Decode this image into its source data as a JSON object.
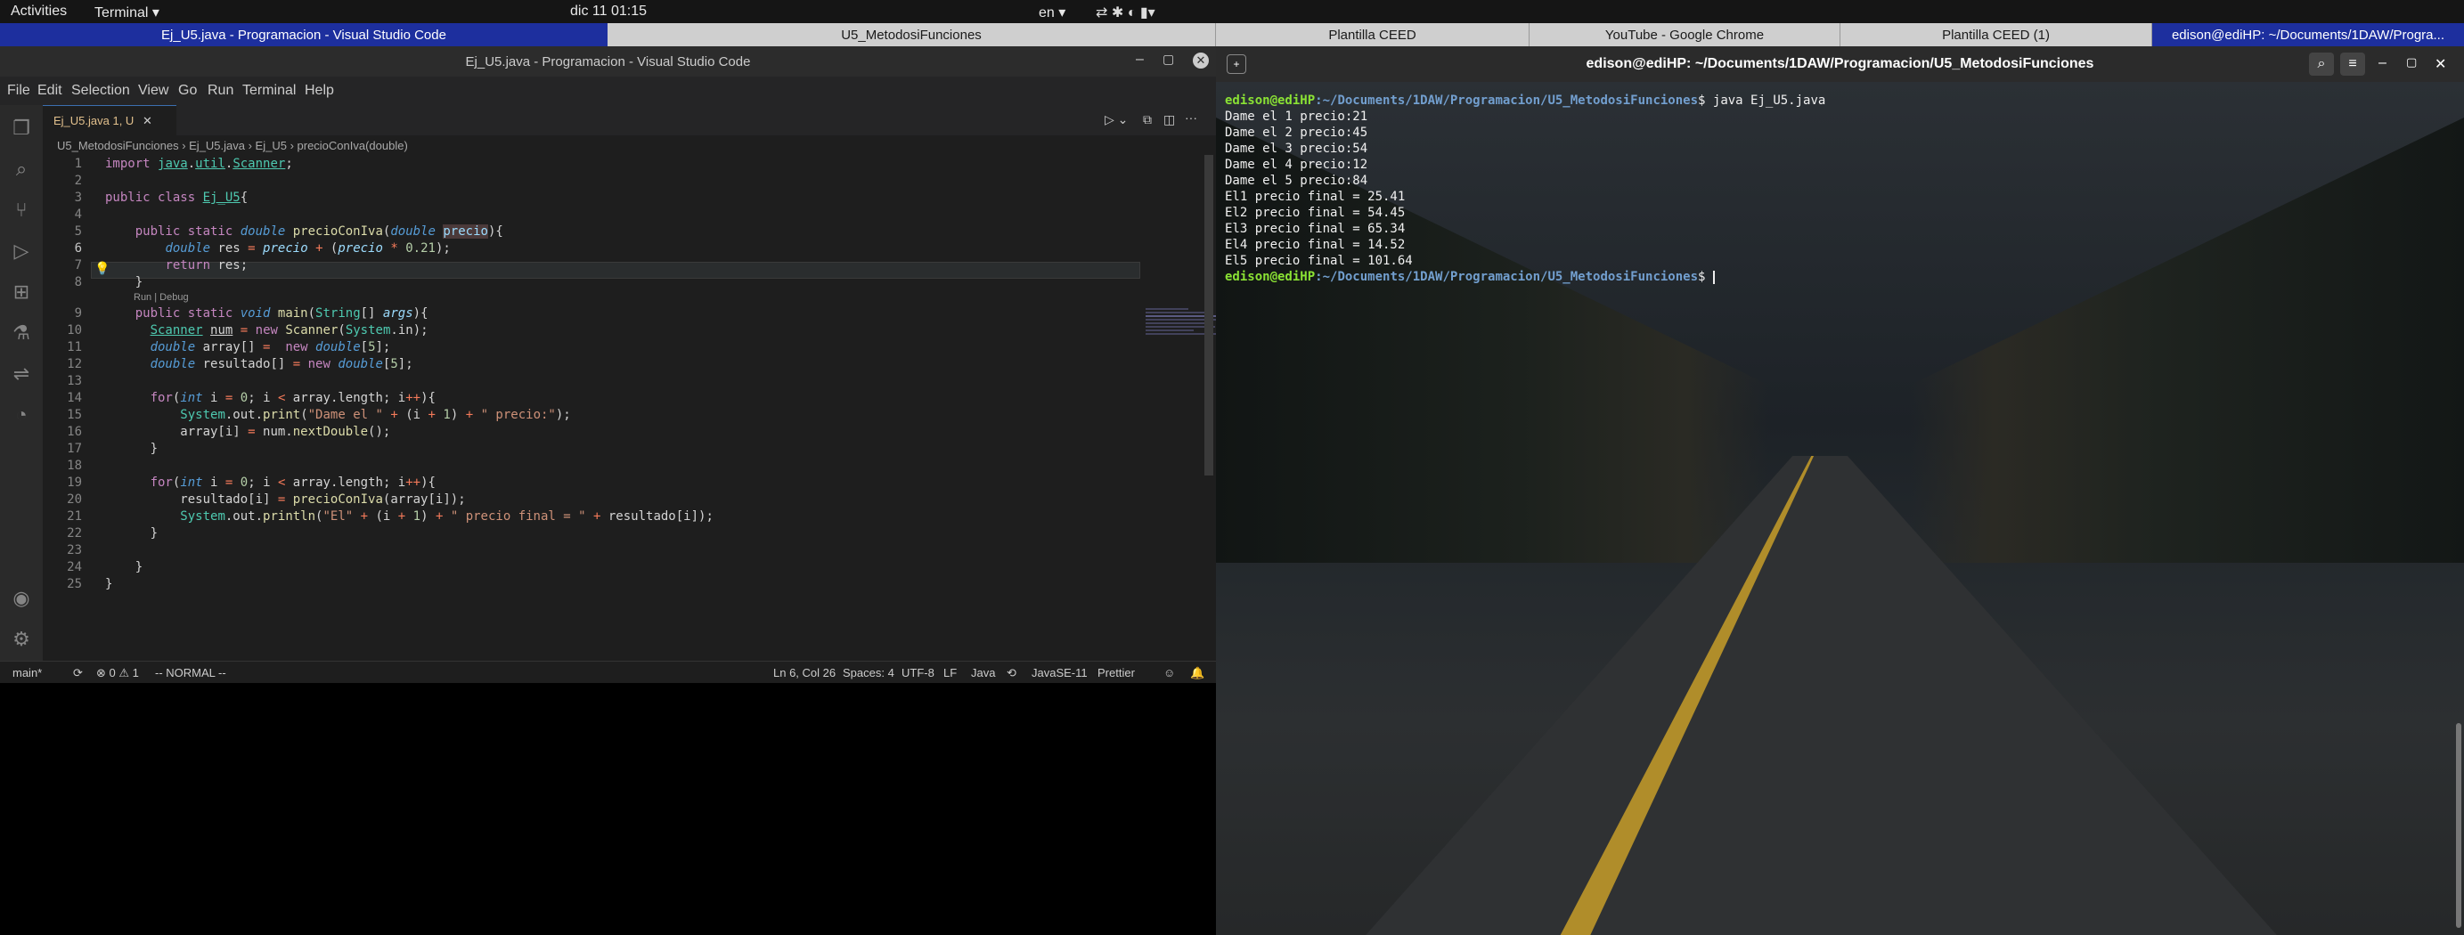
{
  "topbar": {
    "activities": "Activities",
    "app": "Terminal ▾",
    "clock": "dic 11  01:15",
    "lang": "en ▾"
  },
  "taskbar": [
    "Ej_U5.java - Programacion - Visual Studio Code",
    "U5_MetodosiFunciones",
    "Plantilla CEED",
    "YouTube - Google Chrome",
    "Plantilla CEED (1)",
    "edison@ediHP: ~/Documents/1DAW/Progra..."
  ],
  "vscode": {
    "title": "Ej_U5.java - Programacion - Visual Studio Code",
    "menu": [
      "File",
      "Edit",
      "Selection",
      "View",
      "Go",
      "Run",
      "Terminal",
      "Help"
    ],
    "tab": "Ej_U5.java 1, U",
    "breadcrumb": "U5_MetodosiFunciones  ›  Ej_U5.java  ›  Ej_U5  ›  precioConIva(double)",
    "codelens": "Run | Debug",
    "status": {
      "branch": "main*",
      "problems": "⊗ 0 ⚠ 1",
      "mode": "-- NORMAL --",
      "cursor": "Ln 6, Col 26",
      "spaces": "Spaces: 4",
      "enc": "UTF-8",
      "eol": "LF",
      "lang": "Java",
      "jdk": "JavaSE-11",
      "fmt": "Prettier"
    }
  },
  "terminal": {
    "title": "edison@ediHP: ~/Documents/1DAW/Programacion/U5_MetodosiFunciones",
    "prompt_user": "edison@ediHP",
    "prompt_path": ":~/Documents/1DAW/Programacion/U5_MetodosiFunciones",
    "command": "$ java Ej_U5.java",
    "output": "Dame el 1 precio:21\nDame el 2 precio:45\nDame el 3 precio:54\nDame el 4 precio:12\nDame el 5 precio:84\nEl1 precio final = 25.41\nEl2 precio final = 54.45\nEl3 precio final = 65.34\nEl4 precio final = 14.52\nEl5 precio final = 101.64",
    "end_prompt": "$ "
  },
  "colors": {
    "accent": "#1d2f9e",
    "vscode_bg": "#1e1e1e"
  }
}
